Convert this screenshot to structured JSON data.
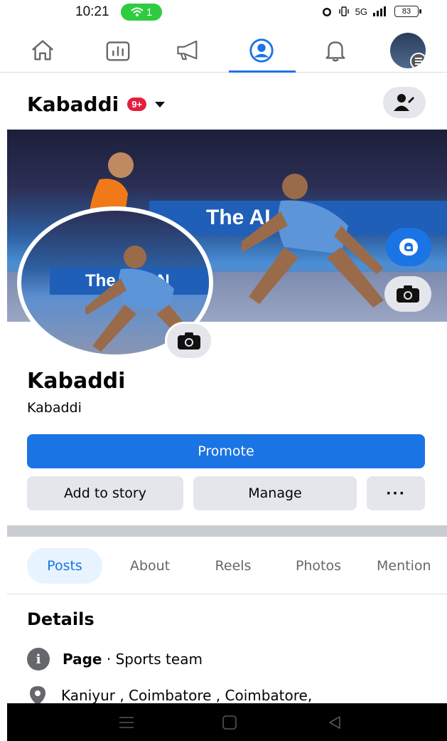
{
  "status_bar": {
    "time": "10:21",
    "hotspot_count": "1",
    "network": "5G",
    "battery": "83"
  },
  "top_nav": {
    "items": [
      {
        "name": "home",
        "icon": "home-icon"
      },
      {
        "name": "dashboard",
        "icon": "chart-icon"
      },
      {
        "name": "ads",
        "icon": "megaphone-icon"
      },
      {
        "name": "profile",
        "icon": "profile-icon",
        "active": true
      },
      {
        "name": "notifications",
        "icon": "bell-icon"
      },
      {
        "name": "menu",
        "icon": "avatar-menu-icon"
      }
    ]
  },
  "header": {
    "page_name": "Kabaddi",
    "badge": "9+"
  },
  "cover": {
    "banner_text": "The ALL NE",
    "profile_banner_text": "The ALL N"
  },
  "profile": {
    "name": "Kabaddi",
    "subtitle": "Kabaddi"
  },
  "actions": {
    "promote": "Promote",
    "add_to_story": "Add to story",
    "manage": "Manage",
    "more": "···"
  },
  "tabs": [
    "Posts",
    "About",
    "Reels",
    "Photos",
    "Mention"
  ],
  "details": {
    "title": "Details",
    "page_label": "Page",
    "page_category": "· Sports team",
    "location": "Kaniyur , Coimbatore , Coimbatore,"
  },
  "colors": {
    "accent": "#1b74e4",
    "badge": "#e41e3f",
    "button_gray": "#e4e6eb"
  }
}
